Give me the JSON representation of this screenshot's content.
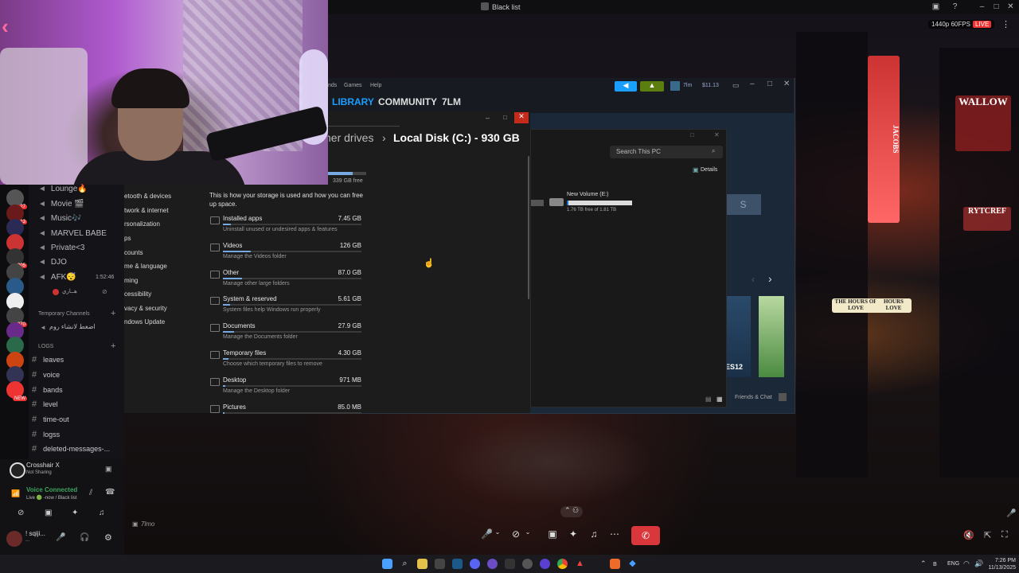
{
  "window": {
    "title": "Black list"
  },
  "stream": {
    "quality": "1440p 60FPS",
    "live": "LIVE"
  },
  "discord": {
    "voice_channels": [
      {
        "label": "Lounge🔥"
      },
      {
        "label": "Movie 🎬"
      },
      {
        "label": "Music🎶"
      },
      {
        "label": "MARVEL BABE"
      },
      {
        "label": "Private<3"
      },
      {
        "label": "DJO"
      },
      {
        "label": "AFK😴"
      }
    ],
    "afk_time": "1:52:46",
    "afk_user": "هــاري",
    "temp_category": "Temporary Channels",
    "temp_channel": "اضغط لانشاء روم",
    "logs_category": "LOGS",
    "text_channels": [
      {
        "label": "leaves"
      },
      {
        "label": "voice"
      },
      {
        "label": "bands"
      },
      {
        "label": "level"
      },
      {
        "label": "time-out"
      },
      {
        "label": "logss"
      },
      {
        "label": "deleted-messages-..."
      }
    ],
    "server_badges": [
      "27",
      "13",
      "205",
      "270",
      "NEW"
    ],
    "activity": {
      "name": "Crosshair X",
      "status": "Not Sharing"
    },
    "voice_status": {
      "title": "Voice Connected",
      "sub": "Live 🟢 -now / Black list"
    },
    "user": {
      "name": "! sqiji...",
      "sub": "..."
    },
    "chat_hint": "7lmo"
  },
  "settings": {
    "nav": [
      "etooth & devices",
      "twork & internet",
      "rsonalization",
      "ps",
      "counts",
      "me & language",
      "ming",
      "cessibility",
      "vacy & security",
      "ndows Update"
    ],
    "breadcrumb_prev": "her drives",
    "breadcrumb_sep": "›",
    "breadcrumb_current": "Local Disk (C:) - 930 GB",
    "free_label": "339 GB free",
    "used_fraction": 0.64,
    "intro": "This is how your storage is used and how you can free up space.",
    "rows": [
      {
        "title": "Installed apps",
        "sub": "Uninstall unused or undesired apps & features",
        "value": "7.45 GB",
        "fill": 0.06
      },
      {
        "title": "Videos",
        "sub": "Manage the Videos folder",
        "value": "126 GB",
        "fill": 0.2
      },
      {
        "title": "Other",
        "sub": "Manage other large folders",
        "value": "87.0 GB",
        "fill": 0.14
      },
      {
        "title": "System & reserved",
        "sub": "System files help Windows run properly",
        "value": "5.61 GB",
        "fill": 0.05
      },
      {
        "title": "Documents",
        "sub": "Manage the Documents folder",
        "value": "27.9 GB",
        "fill": 0.08
      },
      {
        "title": "Temporary files",
        "sub": "Choose which temporary files to remove",
        "value": "4.30 GB",
        "fill": 0.04
      },
      {
        "title": "Desktop",
        "sub": "Manage the Desktop folder",
        "value": "971 MB",
        "fill": 0.02
      },
      {
        "title": "Pictures",
        "sub": "",
        "value": "85.0 MB",
        "fill": 0.01
      }
    ]
  },
  "steam": {
    "menu": [
      "nds",
      "Games",
      "Help"
    ],
    "tabs": [
      "LIBRARY",
      "COMMUNITY",
      "7LM"
    ],
    "user": "7lm",
    "wallet": "$11.13",
    "friends": "Friends & Chat",
    "game_label": "ES12",
    "button_letter": "S"
  },
  "explorer": {
    "search_placeholder": "Search This PC",
    "details": "Details",
    "drive_name": "New Volume (E:)",
    "drive_free": "1.76 TB free of 1.81 TB",
    "drive_fill": 0.03
  },
  "taskbar": {
    "lang": "ENG",
    "time": "7:26 PM",
    "date": "11/13/2025"
  },
  "colors": {
    "steam_blue": "#1a9fff",
    "steam_green": "#5c7e10",
    "discord_red": "#da373c",
    "windows_accent": "#76a9e0",
    "close_red": "#c42b1c"
  }
}
